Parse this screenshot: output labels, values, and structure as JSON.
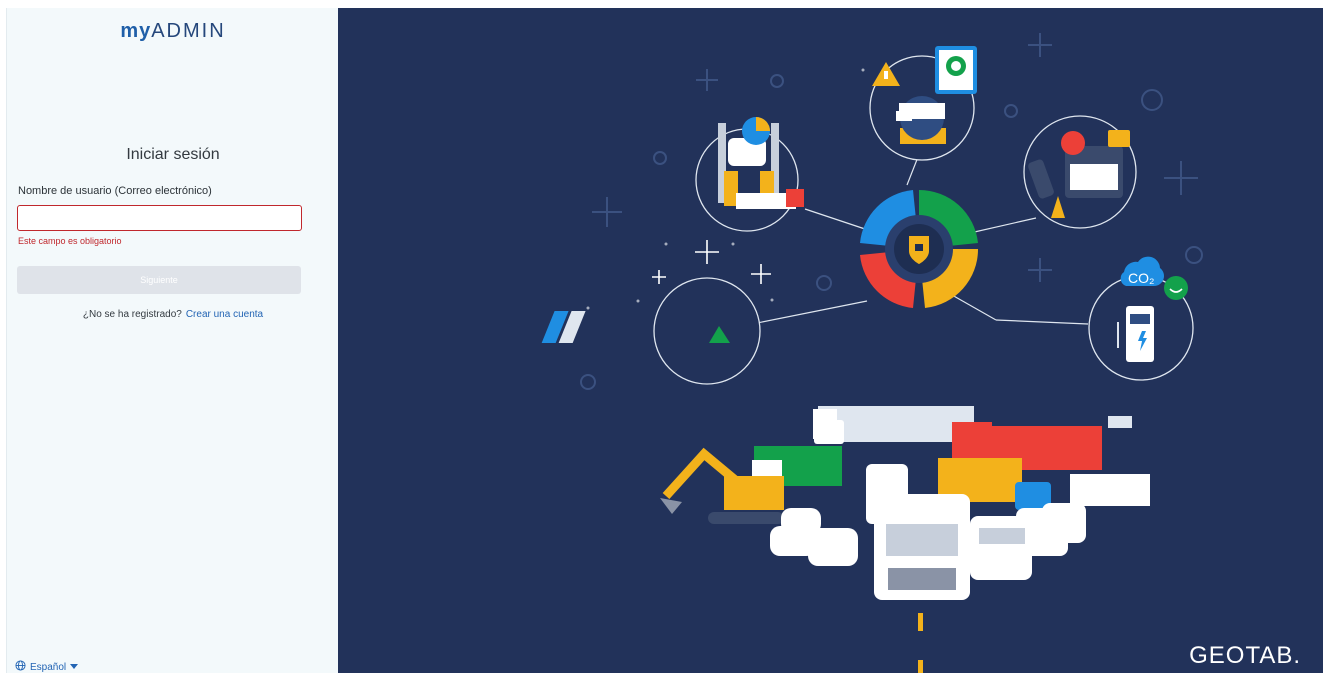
{
  "brand": {
    "logo_prefix": "my",
    "logo_suffix": "ADMIN"
  },
  "login": {
    "title": "Iniciar sesión",
    "username_label": "Nombre de usuario (Correo electrónico)",
    "username_value": "",
    "error": "Este campo es obligatorio",
    "next_label": "Siguiente",
    "register_prompt": "¿No se ha registrado?",
    "register_link": "Crear una cuenta"
  },
  "language": {
    "selected": "Español"
  },
  "footer": {
    "brand": "GEOTAB."
  },
  "colors": {
    "panel_bg": "#f3f9fb",
    "hero_bg": "#22325a",
    "error": "#c0282d",
    "link": "#2365b4",
    "button_disabled": "#dfe3e9"
  }
}
